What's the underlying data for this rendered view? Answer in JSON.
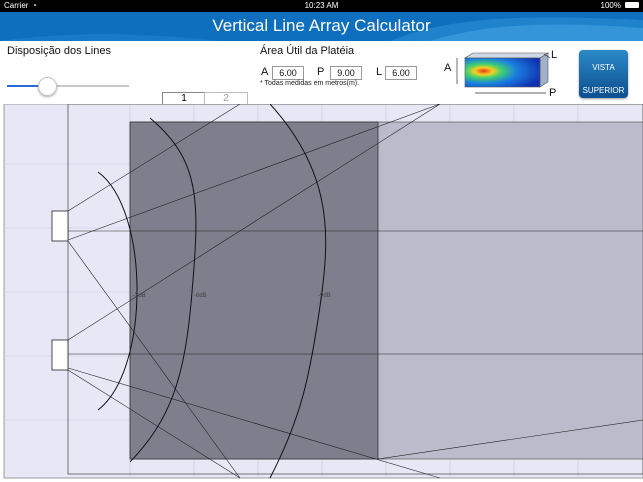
{
  "status": {
    "carrier": "Carrier",
    "time": "10:23 AM",
    "battery": "100%"
  },
  "app": {
    "title": "Vertical Line Array Calculator"
  },
  "controls": {
    "disposicao_label": "Disposição dos Lines",
    "slider_value": 0.33,
    "tabs": [
      "1",
      "2"
    ],
    "area_label": "Área Útil da Platéia",
    "field_a_label": "A",
    "field_a_value": "6.00",
    "field_p_label": "P",
    "field_p_value": "9.00",
    "field_l_label": "L",
    "field_l_value": "6.00",
    "note": "* Todas medidas em metros(m).",
    "diagram_a": "A",
    "diagram_l": "L",
    "diagram_p": "P",
    "vista_line1": "VISTA",
    "vista_line2": "SUPERIOR"
  },
  "plot": {
    "contour_labels": [
      "-3dB",
      "-6dB",
      "-9dB"
    ],
    "colors": {
      "background": "#e7e7f6",
      "audience": "#7f7e8d",
      "shadow": "#bcbbcc",
      "lines": "#000000"
    }
  }
}
